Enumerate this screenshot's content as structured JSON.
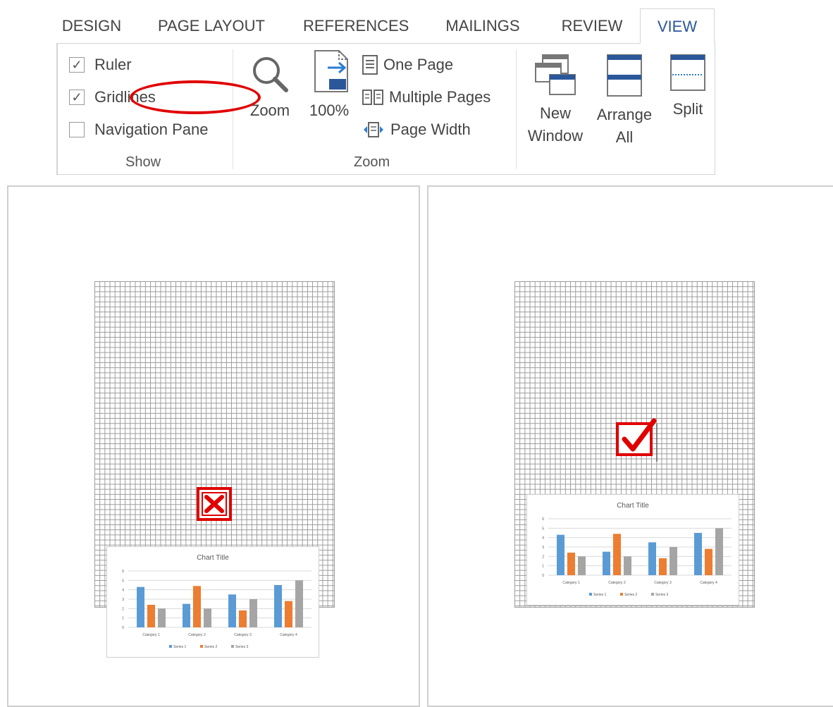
{
  "tabs": [
    {
      "label": "DESIGN"
    },
    {
      "label": "PAGE LAYOUT"
    },
    {
      "label": "REFERENCES"
    },
    {
      "label": "MAILINGS"
    },
    {
      "label": "REVIEW"
    },
    {
      "label": "VIEW",
      "active": true
    }
  ],
  "show_group": {
    "label": "Show",
    "ruler": {
      "label": "Ruler",
      "checked": true
    },
    "gridlines": {
      "label": "Gridlines",
      "checked": true
    },
    "navigation_pane": {
      "label": "Navigation Pane",
      "checked": false
    }
  },
  "zoom_group": {
    "label": "Zoom",
    "zoom": "Zoom",
    "hundred": "100%",
    "hundred_badge": "100",
    "one_page": "One Page",
    "multiple_pages": "Multiple Pages",
    "page_width": "Page Width"
  },
  "window_group": {
    "new_window": [
      "New",
      "Window"
    ],
    "arrange_all": [
      "Arrange",
      "All"
    ],
    "split": "Split"
  },
  "colors": {
    "accent": "#2b579a",
    "annotation_red": "#e00000",
    "series_1": "#5b9bd5",
    "series_2": "#ed7d31",
    "series_3": "#a5a5a5"
  },
  "panes": [
    {
      "name": "left",
      "status_icon": "x-mark-icon"
    },
    {
      "name": "right",
      "status_icon": "check-mark-icon"
    }
  ],
  "chart_data": [
    {
      "type": "bar",
      "title": "Chart Title",
      "categories": [
        "Category 1",
        "Category 2",
        "Category 3",
        "Category 4"
      ],
      "series": [
        {
          "name": "Series 1",
          "values": [
            4.3,
            2.5,
            3.5,
            4.5
          ]
        },
        {
          "name": "Series 2",
          "values": [
            2.4,
            4.4,
            1.8,
            2.8
          ]
        },
        {
          "name": "Series 3",
          "values": [
            2.0,
            2.0,
            3.0,
            5.0
          ]
        }
      ],
      "ylim": [
        0,
        6
      ],
      "yticks": [
        "0",
        "1",
        "2",
        "3",
        "4",
        "5",
        "6"
      ],
      "grid": true,
      "legend": "bottom"
    },
    {
      "type": "bar",
      "title": "Chart Title",
      "categories": [
        "Category 1",
        "Category 2",
        "Category 3",
        "Category 4"
      ],
      "series": [
        {
          "name": "Series 1",
          "values": [
            4.3,
            2.5,
            3.5,
            4.5
          ]
        },
        {
          "name": "Series 2",
          "values": [
            2.4,
            4.4,
            1.8,
            2.8
          ]
        },
        {
          "name": "Series 3",
          "values": [
            2.0,
            2.0,
            3.0,
            5.0
          ]
        }
      ],
      "ylim": [
        0,
        6
      ],
      "yticks": [
        "0",
        "1",
        "2",
        "3",
        "4",
        "5",
        "6"
      ],
      "grid": true,
      "legend": "bottom"
    }
  ]
}
